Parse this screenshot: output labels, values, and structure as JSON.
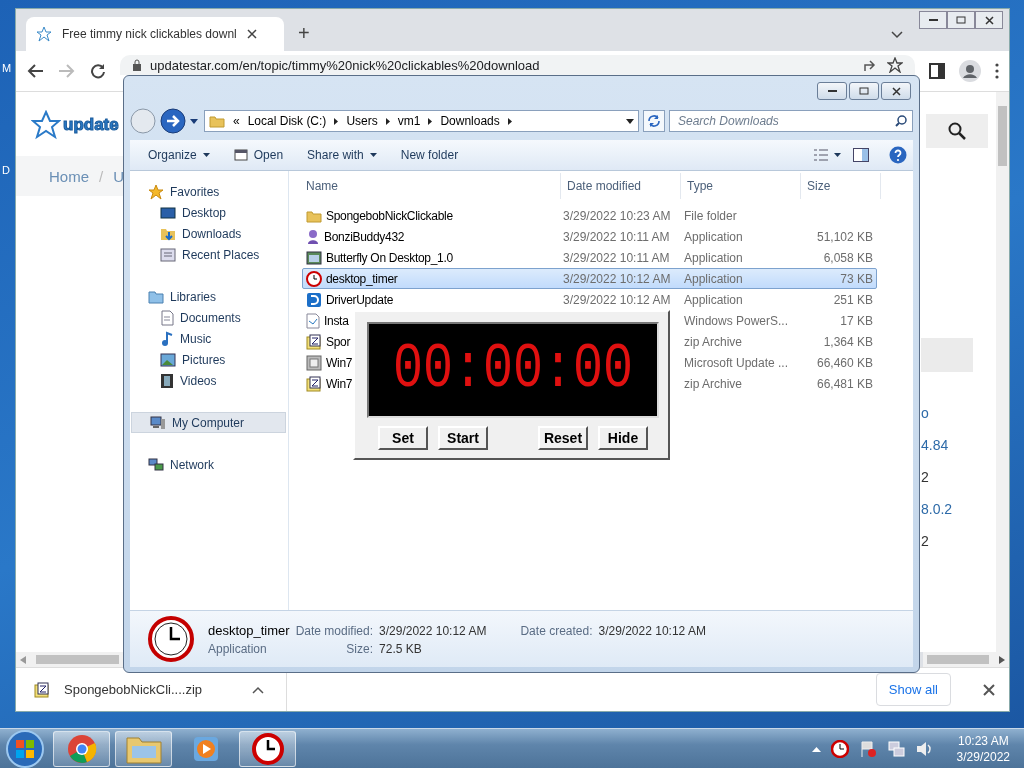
{
  "desktop": {
    "icon_labels": [
      "M",
      "D"
    ]
  },
  "browser": {
    "tab": {
      "title": "Free timmy nick clickables downl",
      "selected": true
    },
    "new_tab": "+",
    "address": "updatestar.com/en/topic/timmy%20nick%20clickables%20download",
    "page": {
      "logo": "update",
      "breadcrumb": [
        "Home",
        "/",
        "U"
      ],
      "side_texts": [
        {
          "text": "o",
          "kind": "link"
        },
        {
          "text": "4.84",
          "kind": "link"
        },
        {
          "text": "2",
          "kind": "plain"
        },
        {
          "text": "8.0.2",
          "kind": "link"
        },
        {
          "text": "2",
          "kind": "plain"
        }
      ]
    },
    "downloads": {
      "items": [
        {
          "name": "SpongebobNickCli....zip"
        }
      ],
      "show_all": "Show all"
    }
  },
  "explorer": {
    "path": [
      "Local Disk (C:)",
      "Users",
      "vm1",
      "Downloads"
    ],
    "path_prefix": "«",
    "search": {
      "placeholder": "Search Downloads"
    },
    "toolbar": [
      {
        "label": "Organize",
        "kind": "menu"
      },
      {
        "label": "Open",
        "kind": "open"
      },
      {
        "label": "Share with",
        "kind": "menu"
      },
      {
        "label": "New folder",
        "kind": "plain"
      }
    ],
    "nav": [
      {
        "label": "Favorites",
        "kind": "star",
        "selected": false,
        "children": [
          {
            "label": "Desktop",
            "kind": "desktop",
            "selected": false
          },
          {
            "label": "Downloads",
            "kind": "downloads",
            "selected": false
          },
          {
            "label": "Recent Places",
            "kind": "recent",
            "selected": false
          }
        ]
      },
      {
        "label": "Libraries",
        "kind": "library",
        "selected": false,
        "children": [
          {
            "label": "Documents",
            "kind": "documents",
            "selected": false
          },
          {
            "label": "Music",
            "kind": "music",
            "selected": false
          },
          {
            "label": "Pictures",
            "kind": "pictures",
            "selected": false
          },
          {
            "label": "Videos",
            "kind": "videos",
            "selected": false
          }
        ]
      },
      {
        "label": "My Computer",
        "kind": "computer",
        "selected": true
      },
      {
        "label": "Network",
        "kind": "network",
        "selected": false
      }
    ],
    "columns": [
      "Name",
      "Date modified",
      "Type",
      "Size"
    ],
    "files": [
      {
        "name": "SpongebobNickClickable",
        "date": "3/29/2022 10:23 AM",
        "type": "File folder",
        "kind": "folder",
        "selected": false
      },
      {
        "name": "BonziBuddy432",
        "date": "3/29/2022 10:11 AM",
        "type": "Application",
        "size": "51,102 KB",
        "kind": "figure",
        "selected": false
      },
      {
        "name": "Butterfly On Desktop_1.0",
        "date": "3/29/2022 10:11 AM",
        "type": "Application",
        "size": "6,058 KB",
        "kind": "app",
        "selected": false
      },
      {
        "name": "desktop_timer",
        "date": "3/29/2022 10:12 AM",
        "type": "Application",
        "size": "73 KB",
        "kind": "clock",
        "selected": true
      },
      {
        "name": "DriverUpdate",
        "date": "3/29/2022 10:12 AM",
        "type": "Application",
        "size": "251 KB",
        "kind": "driver",
        "selected": false
      },
      {
        "name": "Insta",
        "type": "Windows PowerS...",
        "size": "17 KB",
        "kind": "script",
        "selected": false
      },
      {
        "name": "Spor",
        "type": "zip Archive",
        "size": "1,364 KB",
        "kind": "zip",
        "selected": false
      },
      {
        "name": "Win7",
        "type": "Microsoft Update ...",
        "size": "66,460 KB",
        "kind": "update",
        "selected": false
      },
      {
        "name": "Win7",
        "type": "zip Archive",
        "size": "66,481 KB",
        "kind": "zip",
        "selected": false
      }
    ],
    "details": {
      "name": "desktop_timer",
      "type": "Application",
      "fields": [
        {
          "label": "Date modified:",
          "value": "3/29/2022 10:12 AM"
        },
        {
          "label": "Date created:",
          "value": "3/29/2022 10:12 AM"
        },
        {
          "label": "Size:",
          "value": "72.5 KB"
        }
      ]
    }
  },
  "timer": {
    "display": "00:00:00",
    "buttons": [
      "Set",
      "Start",
      "Reset",
      "Hide"
    ]
  },
  "taskbar": {
    "apps": [
      {
        "kind": "chrome",
        "running": true
      },
      {
        "kind": "explorer",
        "running": true
      },
      {
        "kind": "media",
        "running": false
      },
      {
        "kind": "clock",
        "running": true
      }
    ],
    "time": "10:23 AM",
    "date": "3/29/2022"
  }
}
